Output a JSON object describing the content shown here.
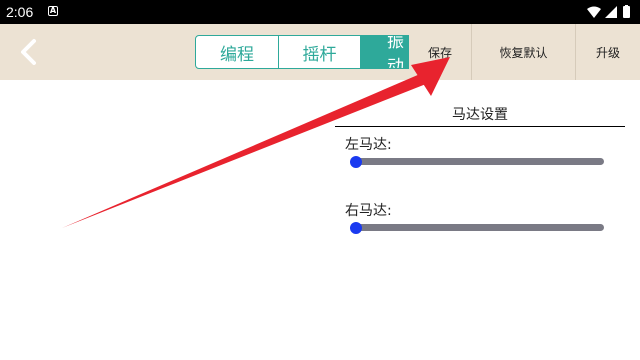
{
  "status_bar": {
    "time": "2:06",
    "notification_icon": "A"
  },
  "toolbar": {
    "tabs": [
      {
        "label": "编程",
        "active": false
      },
      {
        "label": "摇杆",
        "active": false
      },
      {
        "label": "振动",
        "active": true
      }
    ],
    "actions": {
      "save": "保存",
      "restore_default": "恢复默认",
      "upgrade": "升级"
    }
  },
  "motor_settings": {
    "title": "马达设置",
    "left_motor": {
      "label": "左马达:",
      "value": 0
    },
    "right_motor": {
      "label": "右马达:",
      "value": 0
    }
  },
  "colors": {
    "accent": "#2ea99a",
    "toolbar_bg": "#ece2d3",
    "slider_thumb": "#1a3af0",
    "slider_track": "#7a7a85",
    "annotation_arrow": "#e8232e"
  }
}
